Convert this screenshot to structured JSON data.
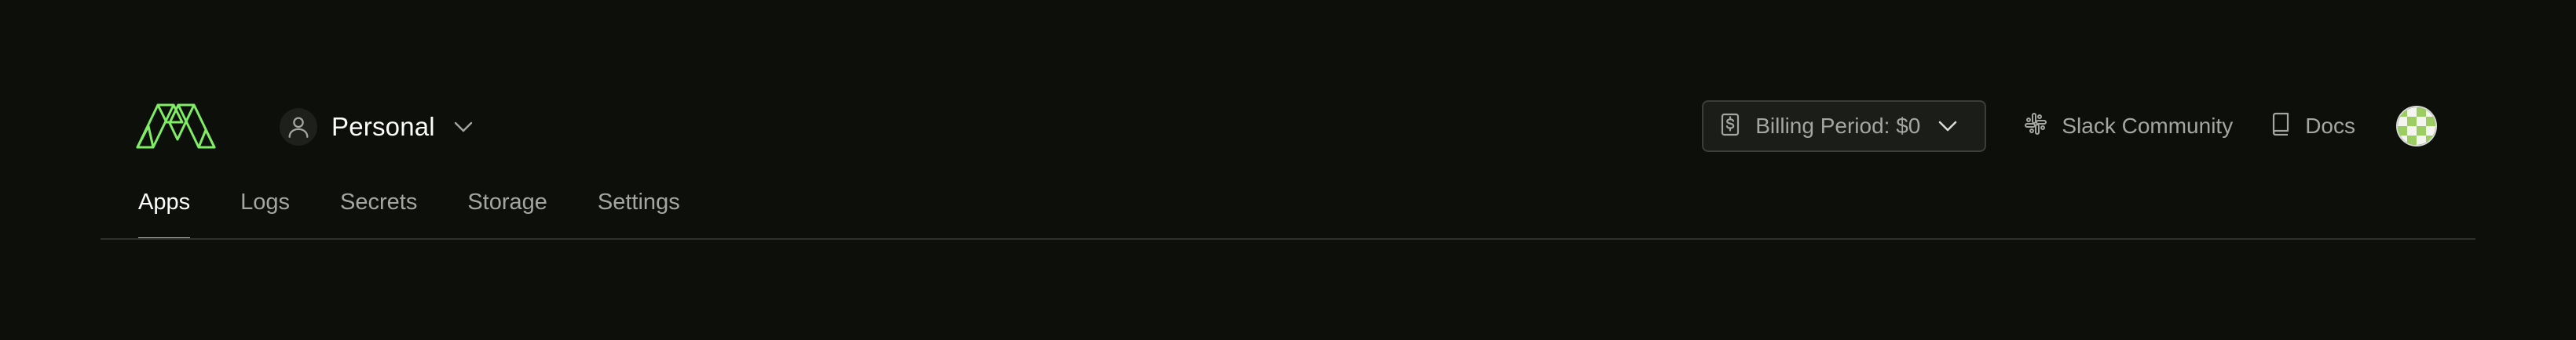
{
  "header": {
    "workspace": {
      "name": "Personal",
      "icon": "user-icon",
      "dropdown_icon": "chevron-down-icon"
    },
    "billing": {
      "label": "Billing Period: $0",
      "icon": "dollar-receipt-icon",
      "dropdown_icon": "chevron-down-icon"
    },
    "links": [
      {
        "label": "Slack Community",
        "icon": "slack-icon"
      },
      {
        "label": "Docs",
        "icon": "book-icon"
      }
    ],
    "avatar": {
      "icon": "checkered-avatar-icon"
    }
  },
  "tabs": [
    {
      "label": "Apps",
      "active": true
    },
    {
      "label": "Logs",
      "active": false
    },
    {
      "label": "Secrets",
      "active": false
    },
    {
      "label": "Storage",
      "active": false
    },
    {
      "label": "Settings",
      "active": false
    }
  ],
  "colors": {
    "background": "#0d0f0b",
    "accent": "#7fee64",
    "muted_text": "#a4a6a1",
    "divider": "#2f322c"
  }
}
